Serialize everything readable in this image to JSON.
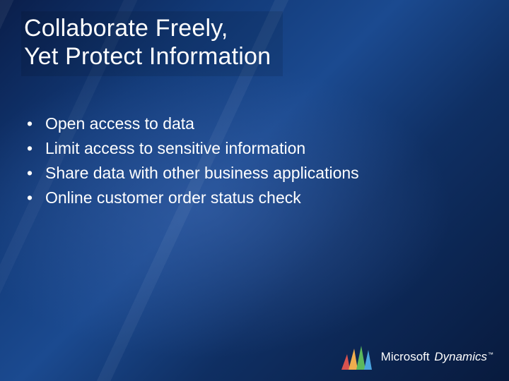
{
  "title": {
    "line1": "Collaborate Freely,",
    "line2": "Yet Protect Information"
  },
  "bullets": [
    "Open access to data",
    "Limit access to sensitive information",
    "Share data with other business applications",
    "Online customer order status check"
  ],
  "footer": {
    "brand": "Microsoft",
    "product": "Dynamics",
    "tm": "™"
  }
}
